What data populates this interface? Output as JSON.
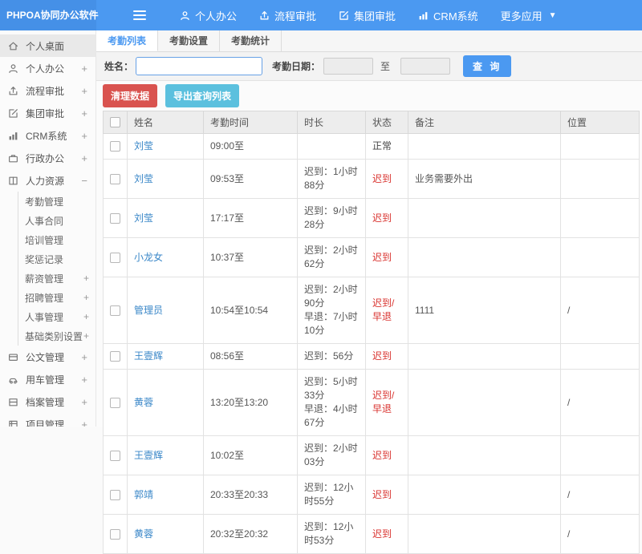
{
  "app_title": "PHPOA协同办公软件",
  "topnav": {
    "items": [
      {
        "icon": "user",
        "label": "个人办公"
      },
      {
        "icon": "flow",
        "label": "流程审批"
      },
      {
        "icon": "edit",
        "label": "集团审批"
      },
      {
        "icon": "chart",
        "label": "CRM系统"
      },
      {
        "icon": "caret",
        "label": "更多应用"
      }
    ]
  },
  "sidebar": {
    "items": [
      {
        "icon": "home",
        "label": "个人桌面",
        "expand": "",
        "active": true
      },
      {
        "icon": "user",
        "label": "个人办公",
        "expand": "+"
      },
      {
        "icon": "flow",
        "label": "流程审批",
        "expand": "+"
      },
      {
        "icon": "edit",
        "label": "集团审批",
        "expand": "+"
      },
      {
        "icon": "chart",
        "label": "CRM系统",
        "expand": "+"
      },
      {
        "icon": "briefcase",
        "label": "行政办公",
        "expand": "+"
      },
      {
        "icon": "book",
        "label": "人力资源",
        "expand": "−",
        "children": [
          {
            "label": "考勤管理",
            "expand": ""
          },
          {
            "label": "人事合同",
            "expand": ""
          },
          {
            "label": "培训管理",
            "expand": ""
          },
          {
            "label": "奖惩记录",
            "expand": ""
          },
          {
            "label": "薪资管理",
            "expand": "+"
          },
          {
            "label": "招聘管理",
            "expand": "+"
          },
          {
            "label": "人事管理",
            "expand": "+"
          },
          {
            "label": "基础类别设置",
            "expand": "+"
          }
        ]
      },
      {
        "icon": "doc",
        "label": "公文管理",
        "expand": "+"
      },
      {
        "icon": "car",
        "label": "用车管理",
        "expand": "+"
      },
      {
        "icon": "archive",
        "label": "档案管理",
        "expand": "+"
      },
      {
        "icon": "project",
        "label": "项目管理",
        "expand": "+"
      }
    ]
  },
  "tabs": [
    {
      "label": "考勤列表",
      "active": true
    },
    {
      "label": "考勤设置",
      "active": false
    },
    {
      "label": "考勤统计",
      "active": false
    }
  ],
  "filter": {
    "name_label": "姓名：",
    "name_value": "",
    "date_label": "考勤日期：",
    "date_from": "",
    "date_to": "",
    "range_separator": "至",
    "search_button": "查 询"
  },
  "actions": {
    "clean_button": "清理数据",
    "export_button": "导出查询列表"
  },
  "attendance_table": {
    "headers": [
      "姓名",
      "考勤时间",
      "时长",
      "状态",
      "备注",
      "位置"
    ],
    "rows": [
      {
        "name": "刘莹",
        "time": "09:00至",
        "duration": [],
        "status": "正常",
        "status_type": "normal",
        "note": "",
        "location": ""
      },
      {
        "name": "刘莹",
        "time": "09:53至",
        "duration": [
          "迟到：1小时88分"
        ],
        "status": "迟到",
        "status_type": "late",
        "note": "业务需要外出",
        "location": ""
      },
      {
        "name": "刘莹",
        "time": "17:17至",
        "duration": [
          "迟到：9小时28分"
        ],
        "status": "迟到",
        "status_type": "late",
        "note": "",
        "location": ""
      },
      {
        "name": "小龙女",
        "time": "10:37至",
        "duration": [
          "迟到：2小时62分"
        ],
        "status": "迟到",
        "status_type": "late",
        "note": "",
        "location": ""
      },
      {
        "name": "管理员",
        "time": "10:54至10:54",
        "duration": [
          "迟到：2小时90分",
          "早退：7小时10分"
        ],
        "status": "迟到/早退",
        "status_type": "late",
        "note": "1111",
        "location": "/"
      },
      {
        "name": "王壹辉",
        "time": "08:56至",
        "duration": [
          "迟到：56分"
        ],
        "status": "迟到",
        "status_type": "late",
        "note": "",
        "location": ""
      },
      {
        "name": "黄蓉",
        "time": "13:20至13:20",
        "duration": [
          "迟到：5小时33分",
          "早退：4小时67分"
        ],
        "status": "迟到/早退",
        "status_type": "late",
        "note": "",
        "location": "/"
      },
      {
        "name": "王壹辉",
        "time": "10:02至",
        "duration": [
          "迟到：2小时03分"
        ],
        "status": "迟到",
        "status_type": "late",
        "note": "",
        "location": ""
      },
      {
        "name": "郭靖",
        "time": "20:33至20:33",
        "duration": [
          "迟到：12小时55分"
        ],
        "status": "迟到",
        "status_type": "late",
        "note": "",
        "location": "/"
      },
      {
        "name": "黄蓉",
        "time": "20:32至20:32",
        "duration": [
          "迟到：12小时53分"
        ],
        "status": "迟到",
        "status_type": "late",
        "note": "",
        "location": "/"
      }
    ]
  },
  "colors": {
    "topbar": "#4b99f1",
    "logo_bg": "#4590e7",
    "accent_blue": "#4b99f1",
    "link_blue": "#3a87c8",
    "status_red": "#d9332f",
    "danger_button": "#d9534f",
    "info_button": "#5bc0de"
  }
}
